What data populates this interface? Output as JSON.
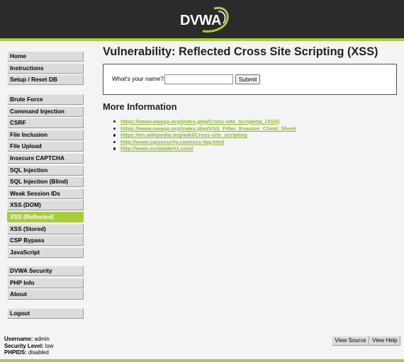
{
  "header": {
    "logo_text": "DVWA",
    "accent_color": "#a6ce39",
    "bg_color": "#2b2b2b"
  },
  "menu": {
    "group1": [
      "Home",
      "Instructions",
      "Setup / Reset DB"
    ],
    "group2": [
      "Brute Force",
      "Command Injection",
      "CSRF",
      "File Inclusion",
      "File Upload",
      "Insecure CAPTCHA",
      "SQL Injection",
      "SQL Injection (Blind)",
      "Weak Session IDs",
      "XSS (DOM)",
      "XSS (Reflected)",
      "XSS (Stored)",
      "CSP Bypass",
      "JavaScript"
    ],
    "group3": [
      "DVWA Security",
      "PHP Info",
      "About"
    ],
    "group4": [
      "Logout"
    ],
    "selected": "XSS (Reflected)"
  },
  "main": {
    "title": "Vulnerability: Reflected Cross Site Scripting (XSS)",
    "form": {
      "label": "What's your name?",
      "input_value": "",
      "submit_label": "Submit"
    },
    "more_info_title": "More Information",
    "links": [
      "https://www.owasp.org/index.php/Cross-site_Scripting_(XSS)",
      "https://www.owasp.org/index.php/XSS_Filter_Evasion_Cheat_Sheet",
      "https://en.wikipedia.org/wiki/Cross-site_scripting",
      "http://www.cgisecurity.com/xss-faq.html",
      "http://www.scriptalert1.com/"
    ]
  },
  "footer": {
    "username_label": "Username:",
    "username": "admin",
    "security_label": "Security Level:",
    "security": "low",
    "phpids_label": "PHPIDS:",
    "phpids": "disabled",
    "view_source": "View Source",
    "view_help": "View Help"
  }
}
